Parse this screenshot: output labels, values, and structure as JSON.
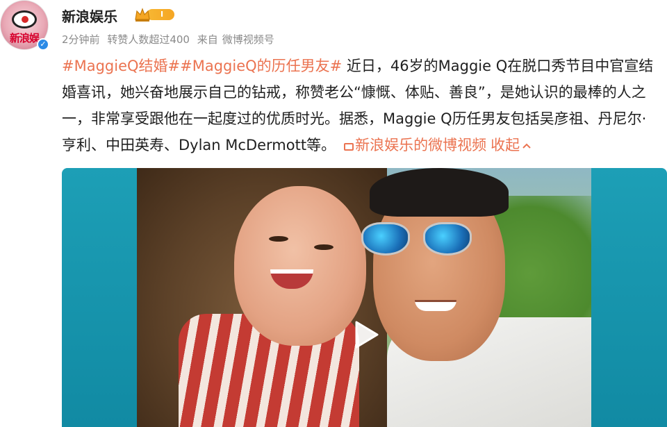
{
  "account": {
    "name": "新浪娱乐",
    "avatar_text": "新浪娱",
    "level_badge": "I",
    "verified": true
  },
  "meta": {
    "time": "2分钟前",
    "reposts": "转赞人数超过400",
    "source_prefix": "来自",
    "source": "微博视频号"
  },
  "post": {
    "hashtag1": "#MaggieQ结婚#",
    "hashtag2": "#MaggieQ的历任男友#",
    "body": " 近日，46岁的Maggie Q在脱口秀节目中官宣结婚喜讯，她兴奋地展示自己的钻戒，称赞老公“慷慨、体贴、善良”，是她认识的最棒的人之一，非常享受跟他在一起度过的优质时光。据悉，Maggie Q历任男友包括吴彦祖、丹尼尔·亨利、中田英寿、Dylan McDermott等。",
    "video_link": "新浪娱乐的微博视频",
    "collapse": "收起"
  },
  "icons": {
    "play": "play-icon",
    "crown": "crown-icon",
    "verified": "verified-icon",
    "video_camera": "video-camera-icon"
  },
  "colors": {
    "accent": "#eb7350",
    "meta": "#8a8a8a",
    "verified": "#2b8ae6",
    "video_bg": "#1d9fb6"
  }
}
